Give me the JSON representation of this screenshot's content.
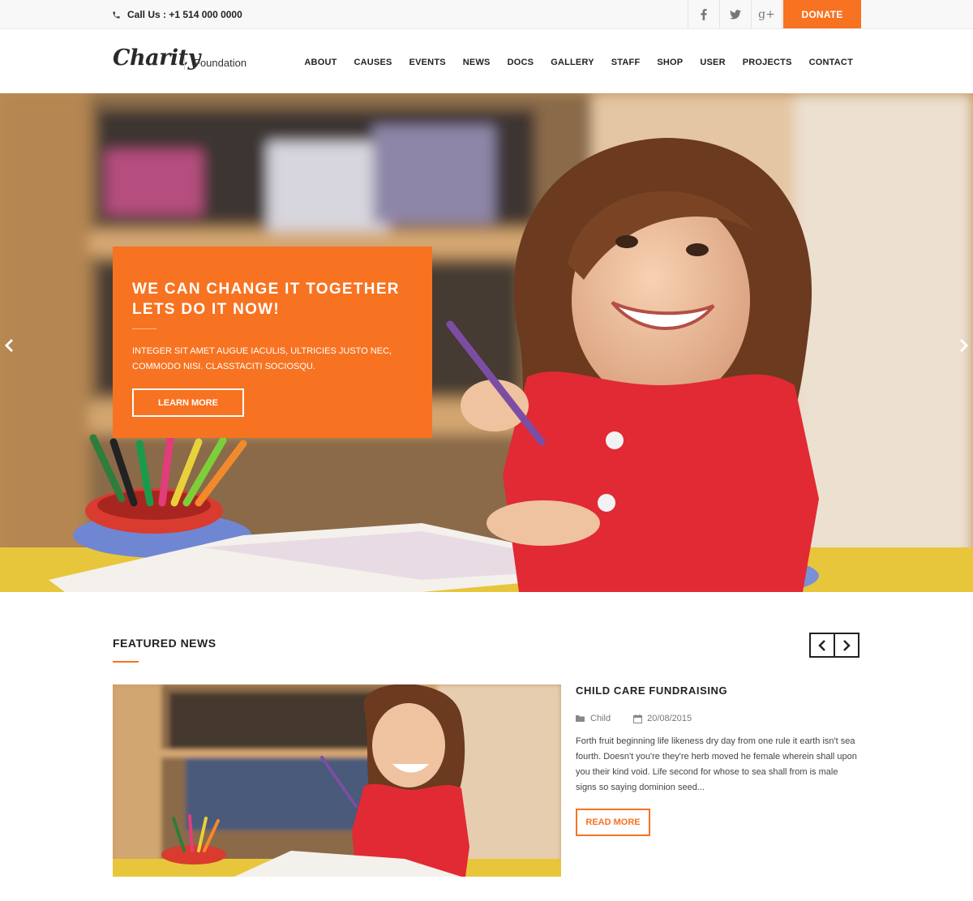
{
  "topbar": {
    "call_text": "Call Us : +1 514 000 0000",
    "phone_icon": "phone-icon",
    "socials": [
      {
        "name": "facebook-icon",
        "glyph": "f"
      },
      {
        "name": "twitter-icon",
        "glyph": "t"
      },
      {
        "name": "google-plus-icon",
        "glyph": "g+"
      }
    ],
    "donate_label": "DONATE"
  },
  "header": {
    "logo": "Charity",
    "tagline": "Foundation",
    "nav": [
      "ABOUT",
      "CAUSES",
      "EVENTS",
      "NEWS",
      "DOCS",
      "GALLERY",
      "STAFF",
      "SHOP",
      "USER",
      "PROJECTS",
      "CONTACT"
    ]
  },
  "hero": {
    "title_line1": "WE CAN CHANGE IT TOGETHER",
    "title_line2": "LETS DO IT NOW!",
    "text_line1": "INTEGER SIT AMET AUGUE IACULIS, ULTRICIES JUSTO NEC,",
    "text_line2": "COMMODO NISI. CLASSTACITI SOCIOSQU.",
    "button_label": "LEARN MORE",
    "prev_icon": "chevron-left-icon",
    "next_icon": "chevron-right-icon"
  },
  "featured": {
    "heading": "FEATURED NEWS",
    "article": {
      "title": "CHILD CARE FUNDRAISING",
      "category": "Child",
      "date": "20/08/2015",
      "excerpt": "Forth fruit beginning life likeness dry day from one rule it earth isn't sea fourth. Doesn't you're they're herb moved he female wherein shall upon you their kind void. Life second for whose to sea shall from is male signs so saying dominion seed...",
      "button_label": "READ MORE"
    }
  },
  "colors": {
    "accent": "#f77321",
    "text": "#222222",
    "topbar_bg": "#f8f8f8"
  }
}
